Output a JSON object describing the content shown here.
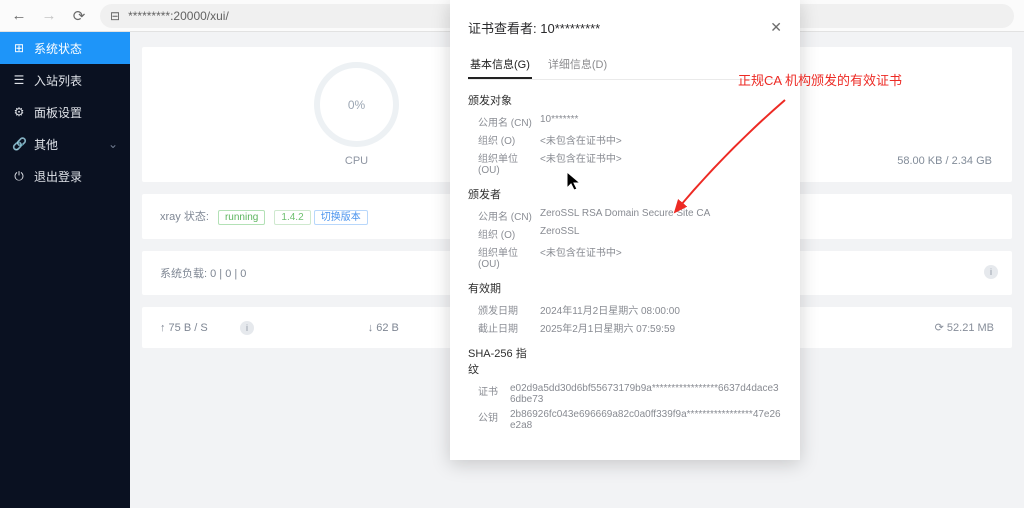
{
  "browser": {
    "url": "*********:20000/xui/"
  },
  "sidebar": {
    "items": [
      {
        "icon": "⊞",
        "label": "系统状态"
      },
      {
        "icon": "☰",
        "label": "入站列表"
      },
      {
        "icon": "⚙",
        "label": "面板设置"
      },
      {
        "icon": "🔗",
        "label": "其他"
      },
      {
        "icon": "⏻",
        "label": "退出登录"
      }
    ]
  },
  "dashboard": {
    "cpu_percent": "0%",
    "cpu_label": "CPU",
    "right_metric": "58.00 KB / 2.34 GB",
    "xray_label": "xray 状态:",
    "xray_status": "running",
    "xray_version": "1.4.2",
    "xray_switch": "切换版本",
    "sysload_label": "系统负载: 0 | 0 | 0",
    "upload": "↑ 75 B / S",
    "download": "↓ 62 B",
    "disk_metric": "⟳ 52.21 MB"
  },
  "cert": {
    "title_prefix": "证书查看者:",
    "title_host": "10*********",
    "tab_basic": "基本信息(G)",
    "tab_detail": "详细信息(D)",
    "subject": {
      "heading": "颁发对象",
      "cn_label": "公用名 (CN)",
      "cn_value": "10*******",
      "o_label": "组织 (O)",
      "o_value": "<未包含在证书中>",
      "ou_label": "组织单位 (OU)",
      "ou_value": "<未包含在证书中>"
    },
    "issuer": {
      "heading": "颁发者",
      "cn_label": "公用名 (CN)",
      "cn_value": "ZeroSSL RSA Domain Secure Site CA",
      "o_label": "组织 (O)",
      "o_value": "ZeroSSL",
      "ou_label": "组织单位 (OU)",
      "ou_value": "<未包含在证书中>"
    },
    "validity": {
      "heading": "有效期",
      "issued_label": "颁发日期",
      "issued_value": "2024年11月2日星期六 08:00:00",
      "expire_label": "截止日期",
      "expire_value": "2025年2月1日星期六 07:59:59"
    },
    "sha": {
      "heading": "SHA-256 指纹",
      "cert_label": "证书",
      "cert_value": "e02d9a5dd30d6bf55673179b9a*****************6637d4dace36dbe73",
      "pub_label": "公钥",
      "pub_value": "2b86926fc043e696669a82c0a0ff339f9a*****************47e26e2a8"
    }
  },
  "annotation": "正规CA 机构颁发的有效证书"
}
